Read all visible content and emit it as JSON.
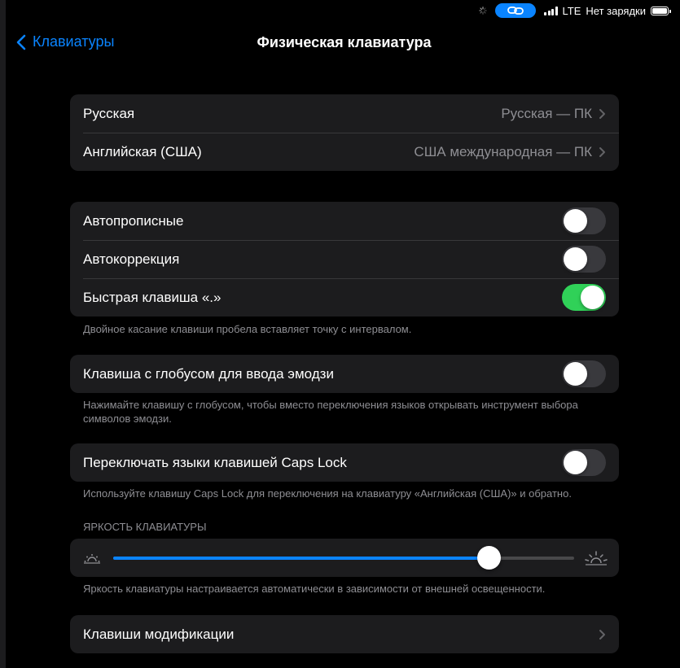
{
  "status": {
    "network": "LTE",
    "charging": "Нет зарядки"
  },
  "nav": {
    "back_label": "Клавиатуры",
    "title": "Физическая клавиатура"
  },
  "keyboards": [
    {
      "label": "Русская",
      "value": "Русская — ПК"
    },
    {
      "label": "Английская (США)",
      "value": "США международная — ПК"
    }
  ],
  "typing": {
    "items": [
      {
        "label": "Автопрописные",
        "on": false
      },
      {
        "label": "Автокоррекция",
        "on": false
      },
      {
        "label": "Быстрая клавиша «.»",
        "on": true
      }
    ],
    "footnote": "Двойное касание клавиши пробела вставляет точку с интервалом."
  },
  "globe": {
    "label": "Клавиша с глобусом для ввода эмодзи",
    "on": false,
    "footnote": "Нажимайте клавишу с глобусом, чтобы вместо переключения языков открывать инструмент выбора символов эмодзи."
  },
  "capslock": {
    "label": "Переключать языки клавишей Caps Lock",
    "on": false,
    "footnote": "Используйте клавишу Caps Lock для переключения на клавиатуру «Английская (США)» и обратно."
  },
  "brightness": {
    "header": "ЯРКОСТЬ КЛАВИАТУРЫ",
    "level": 0.815,
    "footnote": "Яркость клавиатуры настраивается автоматически в зависимости от внешней освещенности."
  },
  "modifiers": {
    "label": "Клавиши модификации"
  },
  "colors": {
    "accent": "#0a84ff",
    "toggle_on": "#30d158",
    "cell_bg": "#1c1c1e"
  }
}
